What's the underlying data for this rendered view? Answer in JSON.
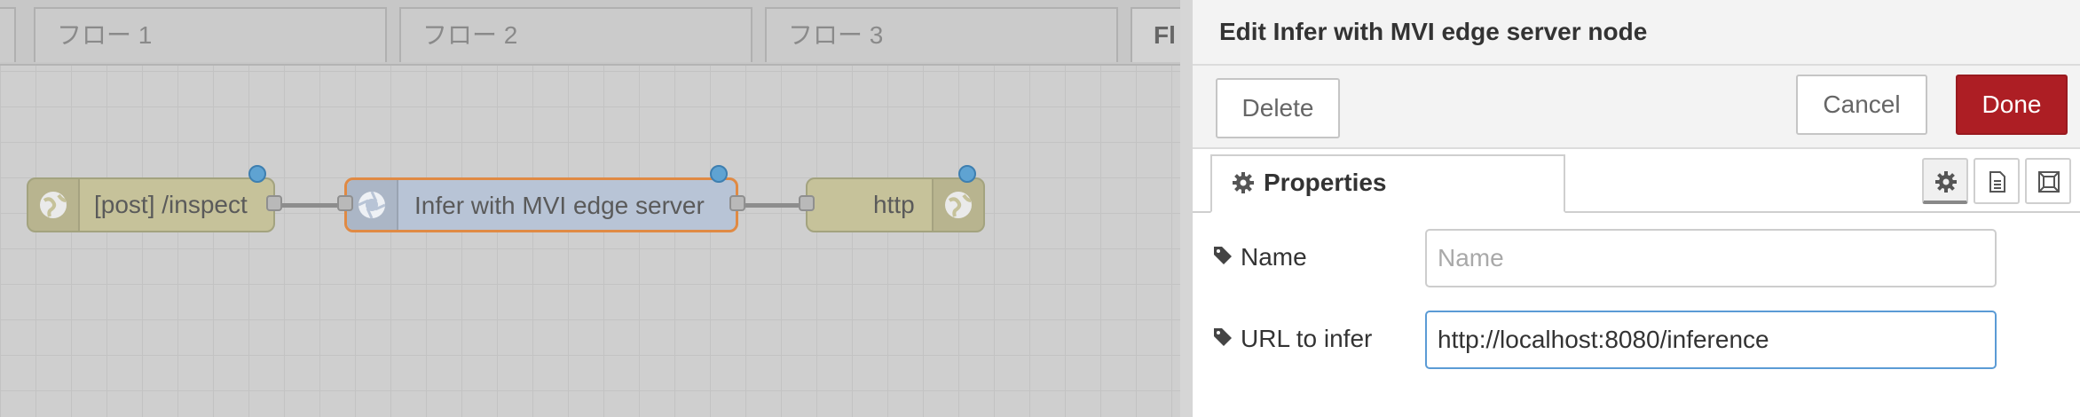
{
  "workspace": {
    "tabs": [
      {
        "label": "フロー 1"
      },
      {
        "label": "フロー 2"
      },
      {
        "label": "フロー 3"
      },
      {
        "label": "Fl"
      }
    ],
    "nodes": [
      {
        "label": "[post] /inspect",
        "icon": "globe-icon"
      },
      {
        "label": "Infer with MVI edge server",
        "icon": "aperture-icon"
      },
      {
        "label": "http",
        "icon": "globe-icon"
      }
    ]
  },
  "tray": {
    "title": "Edit Infer with MVI edge server node",
    "delete_label": "Delete",
    "cancel_label": "Cancel",
    "done_label": "Done",
    "tab_properties": "Properties",
    "fields": {
      "name": {
        "label": "Name",
        "value": "",
        "placeholder": "Name"
      },
      "url": {
        "label": "URL to infer",
        "value": "http://localhost:8080/inference",
        "placeholder": ""
      }
    }
  },
  "colors": {
    "accent_done": "#ad1e24",
    "node_http": "#c6c29a",
    "node_mvi": "#b8c4d6",
    "node_mvi_border": "#e08a44",
    "status_dot": "#5fa3d2"
  }
}
